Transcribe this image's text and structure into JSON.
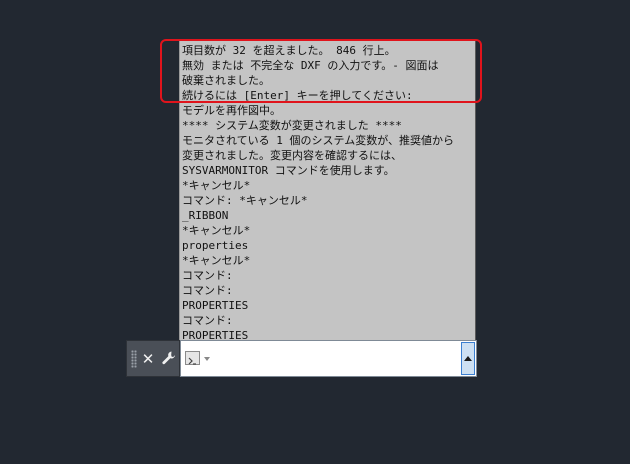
{
  "history": {
    "lines": [
      "項目数が 32 を超えました。 846 行上。",
      "無効 または 不完全な DXF の入力です。- 図面は",
      "破棄されました。",
      "続けるには [Enter] キーを押してください:",
      "モデルを再作図中。",
      "**** システム変数が変更されました ****",
      "モニタされている 1 個のシステム変数が、推奨値から",
      "変更されました。変更内容を確認するには、",
      "SYSVARMONITOR コマンドを使用します。",
      "*キャンセル*",
      "コマンド: *キャンセル*",
      "_RIBBON",
      "*キャンセル*",
      "properties",
      "*キャンセル*",
      "コマンド:",
      "コマンド:",
      "PROPERTIES",
      "コマンド:",
      "PROPERTIES"
    ]
  },
  "command_bar": {
    "close_glyph": "✕",
    "input_value": "",
    "input_placeholder": ""
  },
  "icons": {
    "grip": "grip-handle-icon",
    "close": "close-icon",
    "customize": "wrench-icon",
    "prompt": "command-prompt-icon",
    "history_toggle": "chevron-up-icon"
  },
  "colors": {
    "background": "#222831",
    "history_background": "#c4c4c4",
    "highlight_border": "#e0141c",
    "toggle_accent": "#3b7fd1"
  }
}
